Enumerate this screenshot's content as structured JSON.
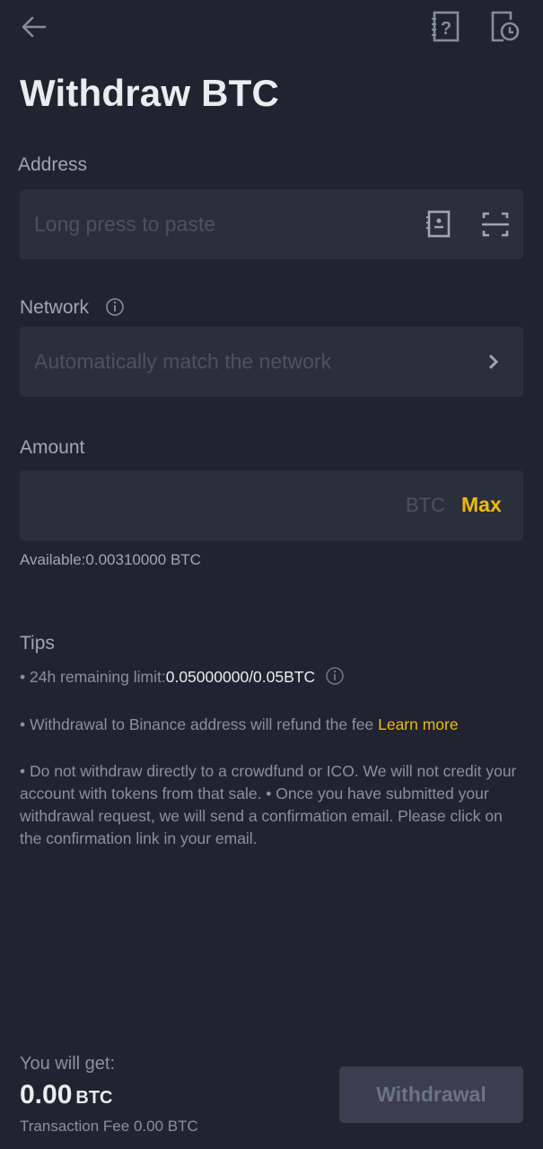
{
  "header": {
    "back_icon": "arrow-left-icon",
    "help_icon": "help-book-icon",
    "history_icon": "history-clock-icon",
    "title": "Withdraw BTC"
  },
  "address": {
    "label": "Address",
    "placeholder": "Long press to paste",
    "value": "",
    "address_book_icon": "address-book-icon",
    "scan_icon": "scan-icon"
  },
  "network": {
    "label": "Network",
    "info_icon": "info-icon",
    "placeholder": "Automatically match the network",
    "chevron_icon": "chevron-right-icon"
  },
  "amount": {
    "label": "Amount",
    "value": "",
    "unit": "BTC",
    "max_label": "Max",
    "available": "Available:0.00310000 BTC"
  },
  "tips": {
    "title": "Tips",
    "limit_prefix": "• 24h remaining limit:",
    "limit_value": "0.05000000/0.05BTC",
    "refund_text": "• Withdrawal to Binance address will refund the fee ",
    "learn_more": "Learn more",
    "warning": "• Do not withdraw directly to a crowdfund or ICO. We will not credit your account with tokens from that sale. • Once you have submitted your withdrawal request, we will send a confirmation email. Please click on the confirmation link in your email."
  },
  "footer": {
    "get_label": "You will get:",
    "get_value": "0.00",
    "get_unit": "BTC",
    "fee_label": "Transaction Fee",
    "fee_value": "0.00 BTC",
    "withdraw_button": "Withdrawal"
  },
  "colors": {
    "background": "#1f2430",
    "field": "#2a2f3b",
    "accent": "#f0b90b",
    "button_disabled": "#3a3f4d"
  }
}
